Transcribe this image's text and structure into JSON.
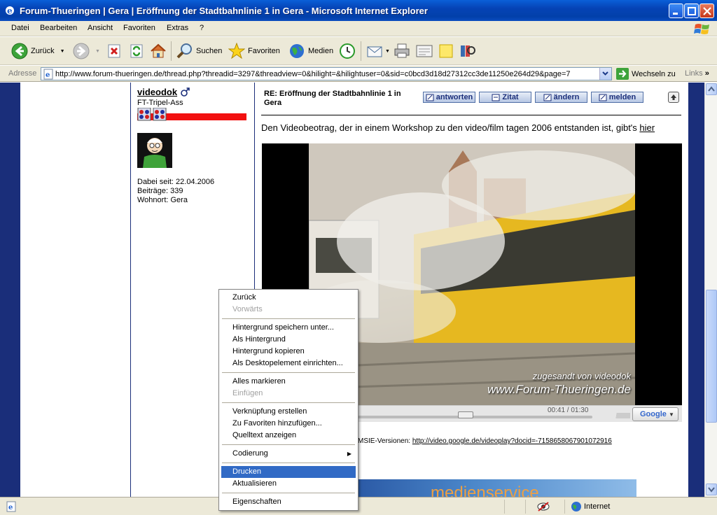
{
  "window": {
    "title": "Forum-Thueringen | Gera | Eröffnung der Stadtbahnlinie 1 in Gera - Microsoft Internet Explorer"
  },
  "menubar": {
    "items": [
      "Datei",
      "Bearbeiten",
      "Ansicht",
      "Favoriten",
      "Extras",
      "?"
    ]
  },
  "toolbar": {
    "back": "Zurück",
    "search": "Suchen",
    "favorites": "Favoriten",
    "media": "Medien"
  },
  "addressbar": {
    "label": "Adresse",
    "url": "http://www.forum-thueringen.de/thread.php?threadid=3297&threadview=0&hilight=&hilightuser=0&sid=c0bcd3d18d27312cc3de11250e264d29&page=7",
    "go": "Wechseln zu",
    "links": "Links"
  },
  "post": {
    "author": {
      "name": "videodok",
      "title": "FT-Tripel-Ass",
      "joined": "Dabei seit: 22.04.2006",
      "posts": "Beiträge: 339",
      "location": "Wohnort: Gera"
    },
    "title": "RE: Eröffnung der Stadtbahnlinie 1 in Gera",
    "buttons": {
      "reply": "antworten",
      "quote": "Zitat",
      "edit": "ändern",
      "report": "melden"
    },
    "text": "Den Videobeotrag, der in einem Workshop zu den video/film tagen 2006 entstanden ist, gibt's ",
    "link": "hier",
    "video": {
      "caption1": "zugesandt von videodok",
      "caption2": "www.Forum-Thueringen.de",
      "time": "00:41 / 01:30",
      "progress": 0.46,
      "provider": "Google"
    },
    "msie_prefix": "MSIE-Versionen: ",
    "msie_link": "http://video.google.de/videoplay?docid=-7158658067901072916",
    "banner_text": "medienservice"
  },
  "statusbar": {
    "zone": "Internet"
  },
  "context_menu": {
    "items": [
      {
        "label": "Zurück",
        "state": "normal"
      },
      {
        "label": "Vorwärts",
        "state": "disabled"
      },
      {
        "label": "Hintergrund speichern unter...",
        "state": "normal"
      },
      {
        "label": "Als Hintergrund",
        "state": "normal"
      },
      {
        "label": "Hintergrund kopieren",
        "state": "normal"
      },
      {
        "label": "Als Desktopelement einrichten...",
        "state": "normal"
      },
      {
        "label": "Alles markieren",
        "state": "normal"
      },
      {
        "label": "Einfügen",
        "state": "disabled"
      },
      {
        "label": "Verknüpfung erstellen",
        "state": "normal"
      },
      {
        "label": "Zu Favoriten hinzufügen...",
        "state": "normal"
      },
      {
        "label": "Quelltext anzeigen",
        "state": "normal"
      },
      {
        "label": "Codierung",
        "state": "submenu"
      },
      {
        "label": "Drucken",
        "state": "selected"
      },
      {
        "label": "Aktualisieren",
        "state": "normal"
      },
      {
        "label": "Eigenschaften",
        "state": "normal"
      }
    ]
  },
  "colors": {
    "xp_blue": "#0543b5",
    "forum_blue": "#1a2e7a",
    "menu_highlight": "#316ac5"
  }
}
